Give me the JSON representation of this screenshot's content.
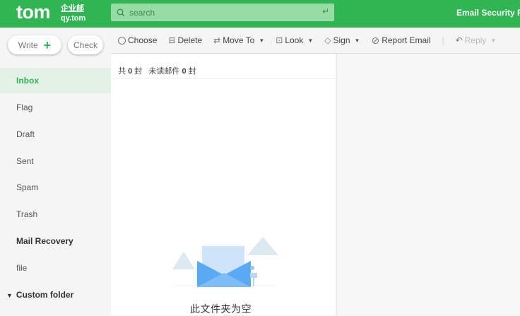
{
  "header": {
    "logo": "tom",
    "logo_sub_cn": "企业邮",
    "logo_sub_domain": "qy.tom",
    "search_placeholder": "search",
    "security_link": "Email Security Re"
  },
  "sidebar": {
    "write_label": "Write",
    "check_label": "Check",
    "items": [
      {
        "label": "Inbox"
      },
      {
        "label": "Flag"
      },
      {
        "label": "Draft"
      },
      {
        "label": "Sent"
      },
      {
        "label": "Spam"
      },
      {
        "label": "Trash"
      },
      {
        "label": "Mail Recovery"
      },
      {
        "label": "file"
      },
      {
        "label": "Custom folder"
      }
    ]
  },
  "toolbar": {
    "choose": "Choose",
    "delete": "Delete",
    "move_to": "Move To",
    "look": "Look",
    "sign": "Sign",
    "report": "Report Email",
    "reply": "Reply"
  },
  "list": {
    "total_prefix": "共",
    "total": "0",
    "total_suffix": "封",
    "unread_prefix": "未读邮件",
    "unread": "0",
    "unread_suffix": "封",
    "empty_text": "此文件夹为空"
  }
}
